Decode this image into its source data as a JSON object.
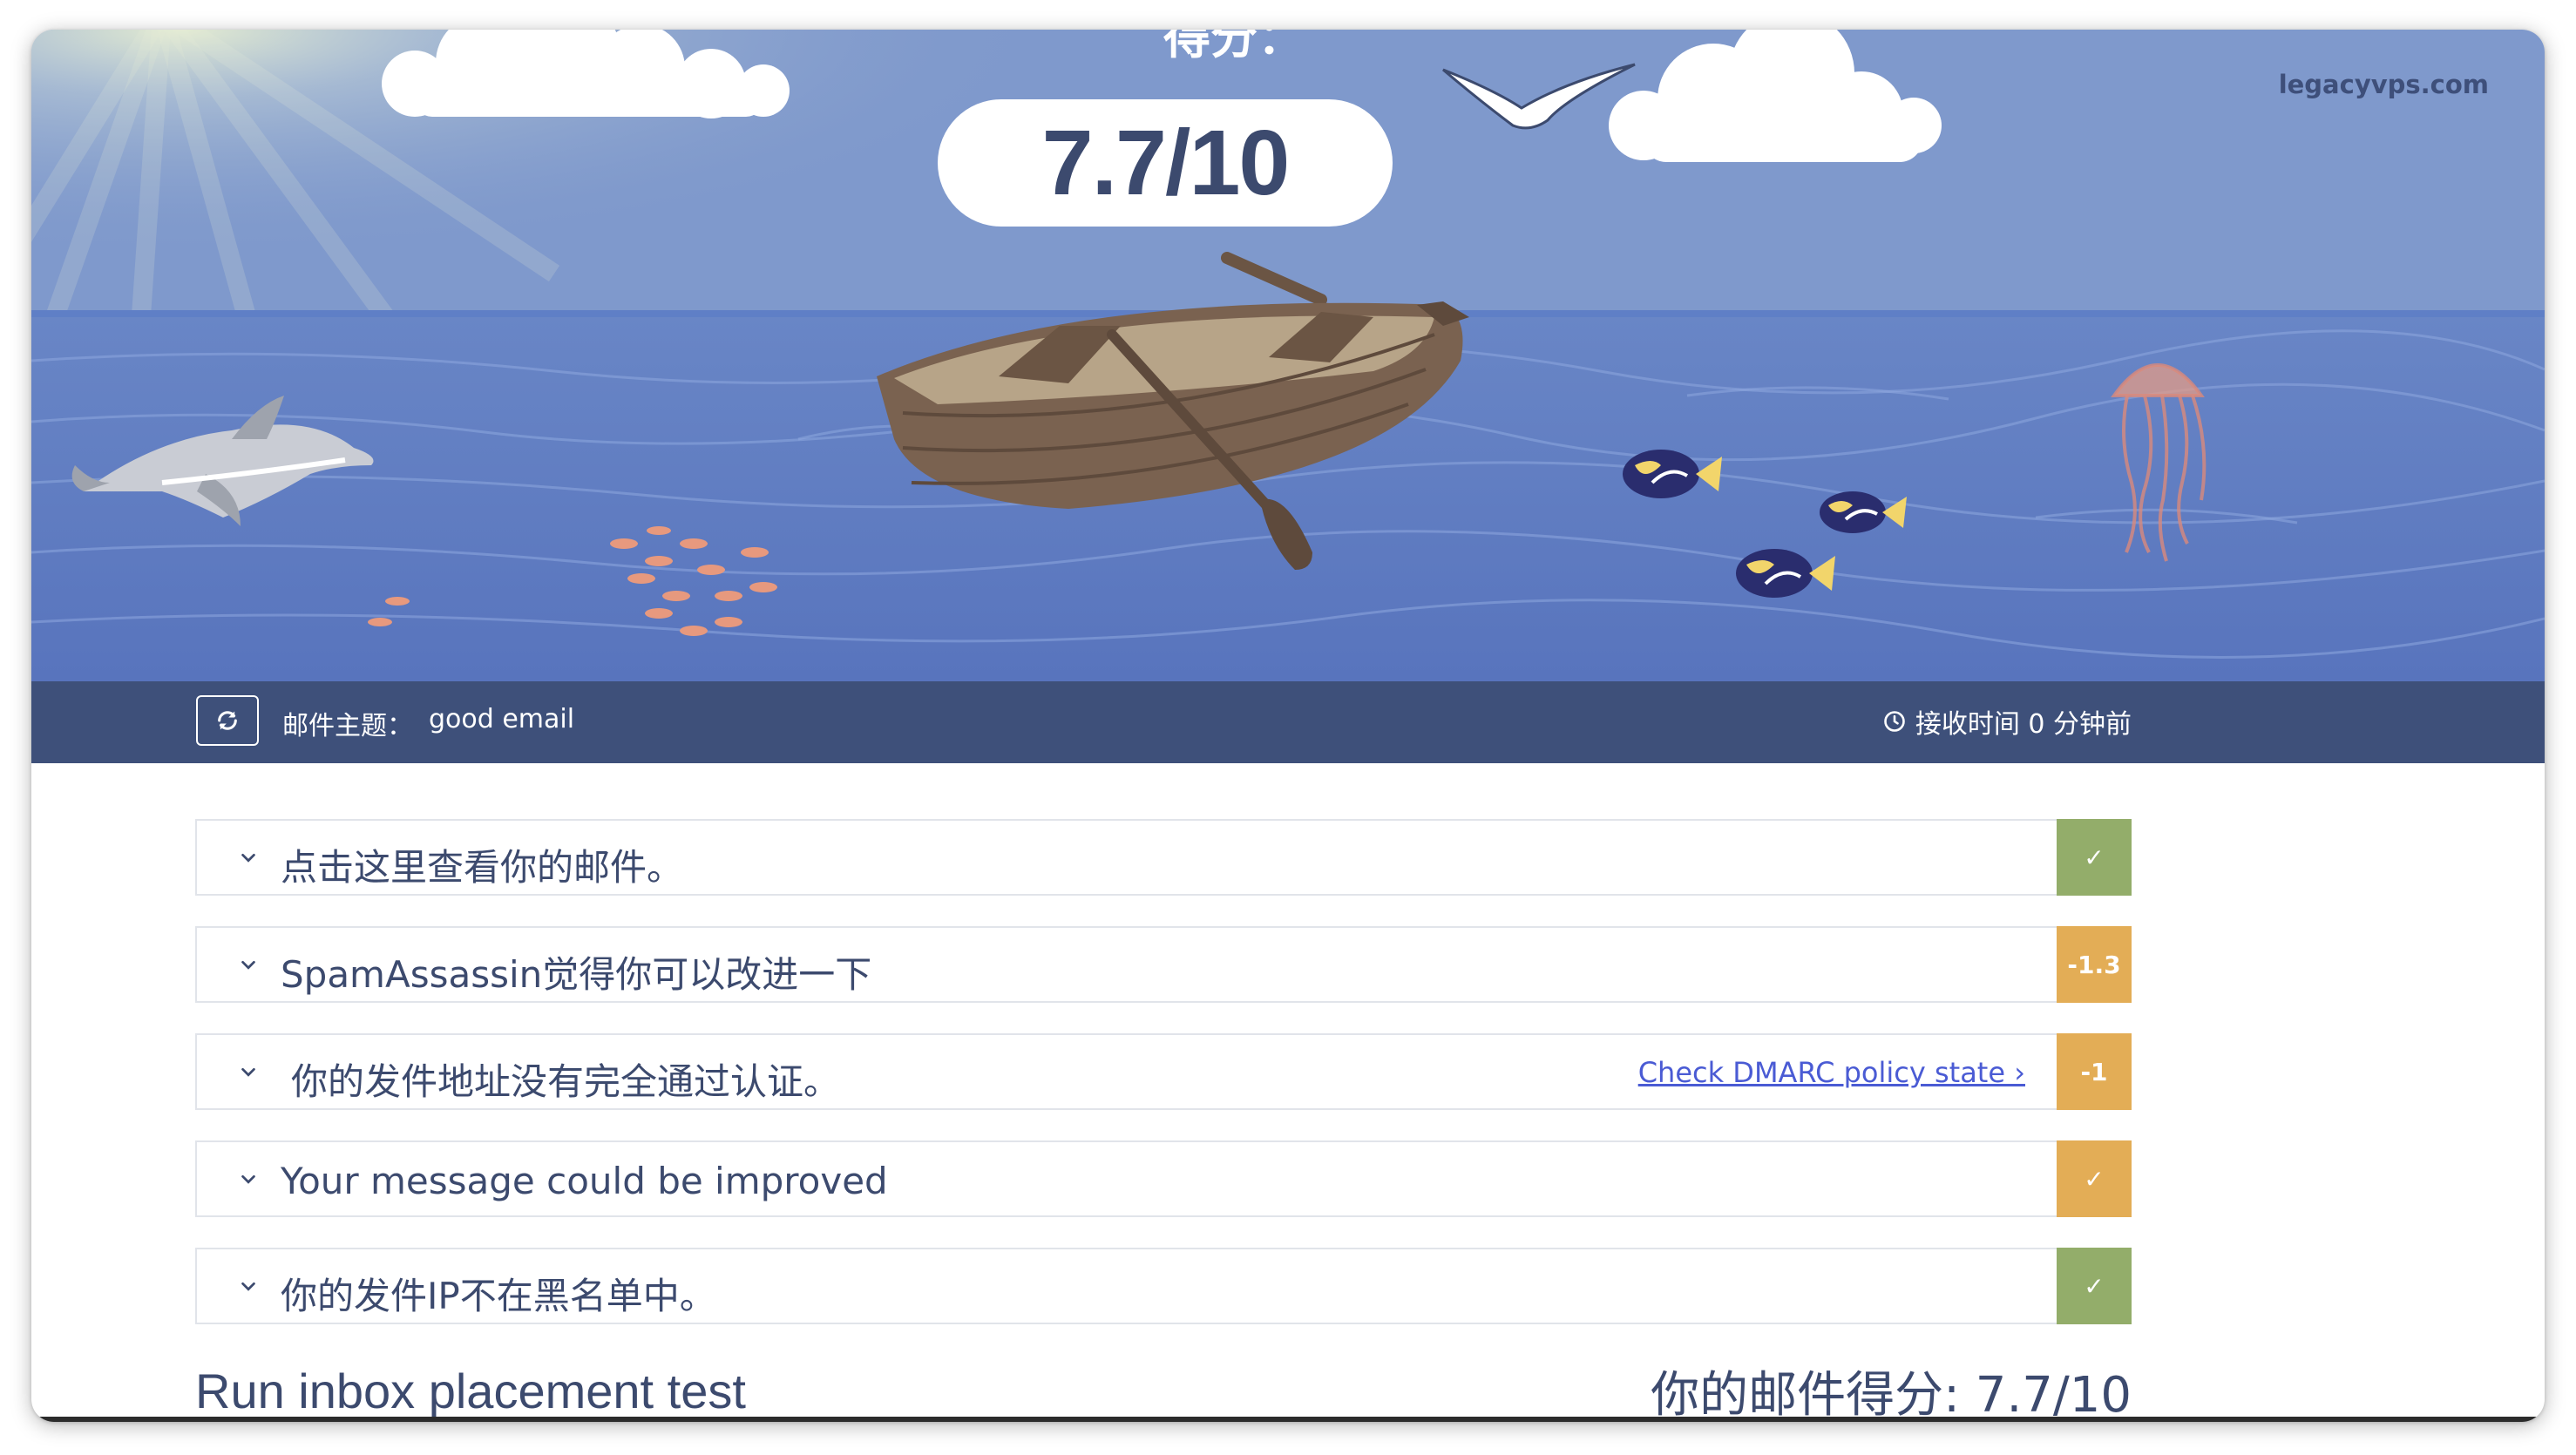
{
  "hero": {
    "score_heading": "得分：",
    "score_value": "7.7/10",
    "watermark": "legacyvps.com"
  },
  "infobar": {
    "subject_label": "邮件主题：",
    "subject_value": "good email",
    "received_text": "接收时间 0 分钟前"
  },
  "checks": [
    {
      "title": "点击这里查看你的邮件。",
      "badge": "✓",
      "badge_color": "#93ad6a"
    },
    {
      "title": "SpamAssassin觉得你可以改进一下",
      "badge": "-1.3",
      "badge_color": "#e3ad56"
    },
    {
      "title": "你的发件地址没有完全通过认证。",
      "link": "Check DMARC policy state ›",
      "badge": "-1",
      "badge_color": "#e3ad56"
    },
    {
      "title": "Your message could be improved",
      "badge": "✓",
      "badge_color": "#e3ad56"
    },
    {
      "title": "你的发件IP不在黑名单中。",
      "badge": "✓",
      "badge_color": "#93ad6a"
    }
  ],
  "footer": {
    "left": "Run inbox placement test",
    "right": "你的邮件得分: 7.7/10"
  },
  "colors": {
    "sky": "#7f99cc",
    "sea": "#5a79bf",
    "bar": "#3e507a",
    "text": "#3c4a6e",
    "green": "#93ad6a",
    "orange": "#e3ad56"
  }
}
